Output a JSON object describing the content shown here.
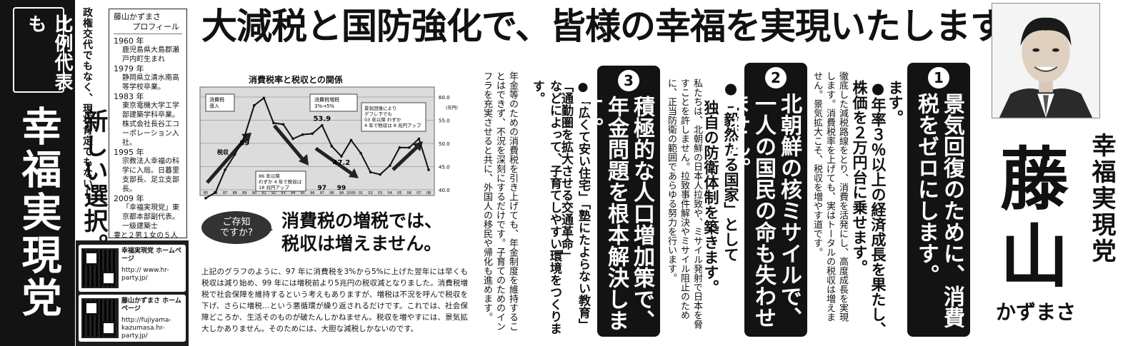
{
  "left": {
    "hirei": "比例代表も",
    "party": "幸福実現党",
    "slogan_small": "政権交代でもなく、現状肯定でもない―",
    "slogan_big": "新しい選択。"
  },
  "profile": {
    "name": "藤山かずまさ",
    "sub": "プロフィール",
    "entries": [
      {
        "year": "1960 年",
        "text": "鹿児島県大島郡瀬戸内町生まれ"
      },
      {
        "year": "1979 年",
        "text": "静岡県立清水南高等学校卒業。"
      },
      {
        "year": "1983 年",
        "text": "東京電機大学工学部建築学科卒業。株式会社長谷工コーポレーション入社。"
      },
      {
        "year": "1995 年",
        "text": "宗教法人幸福の科学に入局。日暮里支部長、足立支部長。"
      },
      {
        "year": "2009 年",
        "text": "「幸福実現党」東京都本部副代表。"
      }
    ],
    "qual": "一級建築士",
    "family": "妻と２男１女の５人家族"
  },
  "qr": [
    {
      "title": "幸福実現党 ホームページ",
      "url": "http:// www.hr-party.jp/"
    },
    {
      "title": "藤山かずまさ ホームページ",
      "url": "http://fujiyama-kazumasa.hr-party.jp/"
    }
  ],
  "headline": "大減税と国防強化で、皆様の幸福を実現いたします。",
  "chart_data": {
    "type": "line",
    "title": "消費税率と税収との関係",
    "x": [
      "85",
      "86",
      "87",
      "88",
      "89",
      "90",
      "91",
      "92",
      "93",
      "94",
      "95",
      "96",
      "97",
      "98",
      "99",
      "2000",
      "01",
      "02",
      "03",
      "04",
      "05",
      "06",
      "07",
      "08"
    ],
    "values": [
      38.2,
      39.4,
      44.3,
      47.6,
      51.5,
      58.2,
      59.8,
      54.4,
      54.1,
      51.0,
      51.9,
      52.1,
      53.9,
      49.4,
      47.2,
      50.7,
      47.9,
      43.8,
      43.3,
      45.2,
      49.1,
      49.1,
      51.0,
      44.3
    ],
    "ylim": [
      40,
      60
    ],
    "yticks": [
      "60.0",
      "55.0",
      "50.0",
      "45.0",
      "40.0"
    ],
    "yunit": "(兆円)",
    "series_label": "税収",
    "point_labels": [
      "89",
      "53.9",
      "47.2",
      "97",
      "99"
    ],
    "annotations": [
      "消費税 導入",
      "消費税増税 3%→5%",
      "景気回復により デフレ下でも 03 年以降 わずか 4 年で税収は 8 兆円アップ",
      "86 年以降 わずか 4 年で税収は 18 兆円アップ"
    ]
  },
  "know": {
    "bubble_1": "ご存知",
    "bubble_2": "ですか?",
    "line1": "消費税の増税では、",
    "line2": "税収は増えません。"
  },
  "body_text": "上記のグラフのように、97 年に消費税を3%から5%に上げた翌年には早くも税収は減り始め、99 年には増税前より5兆円の税収減となりました。消費税増税で社会保障を維持するという考えもありますが、増税は不況を呼んで税収を下げ、さらに増税…という悪循環が繰り返されるだけです。これでは、社会保障どころか、生活そのものが破たんしかねません。税収を増やすには、景気拡大しかありません。そのためには、大胆な減税しかないのです。",
  "policy1": {
    "num": "1",
    "title": "景気回復のために、消費税をゼロにします。",
    "bullet1": "●消費税、相続税、贈与税をゼロにします。",
    "bullet2": "●年率３％以上の経済成長を果たし、株価を２万円台に乗せます。",
    "body": "徹底した減税路線をとり、消費を活発にし、高度成長を実現します。消費税率を上げても、実はトータルの税収は増えません。景気拡大こそ、税収を増やす道です。"
  },
  "policy2": {
    "num": "2",
    "title": "北朝鮮の核ミサイルで、一人の国民の命も失わせません。",
    "bullet1": "●「毅然たる国家」として",
    "bullet2": "独自の防衛体制を築きます。",
    "body": "私たちは、北朝鮮の日本人拉致や、ミサイル発射で日本を脅すことを許しません。拉致事件解決やミサイル阻止のために、正当防衛の範囲であらゆる努力を行います。"
  },
  "policy3": {
    "num": "3",
    "title": "積極的な人口増加策で、年金問題を根本解決します。",
    "bullet1": "●「広くて安い住宅」「塾にたよらない教育」",
    "bullet2": "「通勤圏を拡大させる交通革命」",
    "bullet3": "などによって、子育てしやすい環境をつくります。",
    "body": "年金等のための消費税を引き上げても、年金制度を維持することはできず、不況を深刻にするだけです。子育てのためのインフラを充実させると共に、外国人の移民や帰化も進めます。"
  },
  "candidate": {
    "party": "幸福実現党",
    "name": "藤山",
    "kana": "かずまさ"
  },
  "colors": {
    "ink": "#131313",
    "paper": "#ffffff",
    "chart_bg": "#dcdcdc"
  }
}
